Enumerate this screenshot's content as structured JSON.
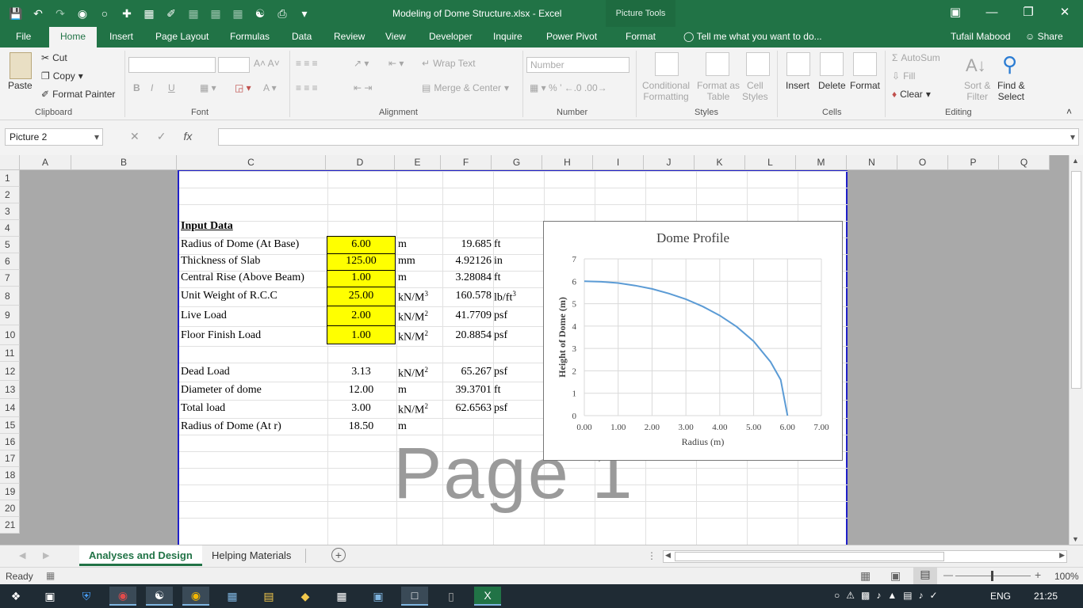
{
  "window": {
    "title": "Modeling of Dome Structure.xlsx - Excel",
    "context_tab": "Picture Tools"
  },
  "ribbon_tabs": [
    "File",
    "Home",
    "Insert",
    "Page Layout",
    "Formulas",
    "Data",
    "Review",
    "View",
    "Developer",
    "Inquire",
    "Power Pivot",
    "Format"
  ],
  "tell_me": "Tell me what you want to do...",
  "user": "Tufail Mabood",
  "share": "Share",
  "ribbon": {
    "clipboard": {
      "paste": "Paste",
      "cut": "Cut",
      "copy": "Copy",
      "format_painter": "Format Painter",
      "label": "Clipboard"
    },
    "font": {
      "label": "Font"
    },
    "alignment": {
      "wrap_text": "Wrap Text",
      "merge_center": "Merge & Center",
      "label": "Alignment"
    },
    "number": {
      "format": "Number",
      "label": "Number"
    },
    "styles": {
      "conditional": "Conditional",
      "formatting": "Formatting",
      "format_as": "Format as",
      "table": "Table",
      "cell": "Cell",
      "styles_txt": "Styles",
      "label": "Styles"
    },
    "cells": {
      "insert": "Insert",
      "delete": "Delete",
      "format": "Format",
      "label": "Cells"
    },
    "editing": {
      "autosum": "AutoSum",
      "fill": "Fill",
      "clear": "Clear",
      "sort": "Sort &",
      "filter": "Filter",
      "find": "Find &",
      "select": "Select",
      "label": "Editing"
    }
  },
  "name_box": "Picture 2",
  "columns": [
    "A",
    "B",
    "C",
    "D",
    "E",
    "F",
    "G",
    "H",
    "I",
    "J",
    "K",
    "L",
    "M",
    "N",
    "O",
    "P",
    "Q"
  ],
  "rows": [
    "1",
    "2",
    "3",
    "4",
    "5",
    "6",
    "7",
    "8",
    "9",
    "10",
    "11",
    "12",
    "13",
    "14",
    "15",
    "16",
    "17",
    "18",
    "19",
    "20",
    "21"
  ],
  "sheet": {
    "heading": "Input Data",
    "inputs": [
      {
        "label": "Radius of Dome (At Base)",
        "value": "6.00",
        "unit": "m",
        "sup": "",
        "conv": "19.685",
        "conv_unit": "ft",
        "conv_sup": ""
      },
      {
        "label": "Thickness of Slab",
        "value": "125.00",
        "unit": "mm",
        "sup": "",
        "conv": "4.92126",
        "conv_unit": "in",
        "conv_sup": ""
      },
      {
        "label": "Central Rise (Above Beam)",
        "value": "1.00",
        "unit": "m",
        "sup": "",
        "conv": "3.28084",
        "conv_unit": "ft",
        "conv_sup": ""
      },
      {
        "label": "Unit Weight of R.C.C",
        "value": "25.00",
        "unit": "kN/M",
        "sup": "3",
        "conv": "160.578",
        "conv_unit": "lb/ft",
        "conv_sup": "3"
      },
      {
        "label": "Live Load",
        "value": "2.00",
        "unit": "kN/M",
        "sup": "2",
        "conv": "41.7709",
        "conv_unit": "psf",
        "conv_sup": ""
      },
      {
        "label": "Floor Finish Load",
        "value": "1.00",
        "unit": "kN/M",
        "sup": "2",
        "conv": "20.8854",
        "conv_unit": "psf",
        "conv_sup": ""
      }
    ],
    "results": [
      {
        "label": "Dead Load",
        "value": "3.13",
        "unit": "kN/M",
        "sup": "2",
        "conv": "65.267",
        "conv_unit": "psf"
      },
      {
        "label": "Diameter of dome",
        "value": "12.00",
        "unit": "m",
        "sup": "",
        "conv": "39.3701",
        "conv_unit": "ft"
      },
      {
        "label": "Total load",
        "value": "3.00",
        "unit": "kN/M",
        "sup": "2",
        "conv": "62.6563",
        "conv_unit": "psf"
      },
      {
        "label": "Radius of Dome (At r)",
        "value": "18.50",
        "unit": "m",
        "sup": "",
        "conv": "",
        "conv_unit": ""
      }
    ],
    "watermark": "Page 1"
  },
  "chart_data": {
    "type": "line",
    "title": "Dome Profile",
    "xlabel": "Radius (m)",
    "ylabel": "Height of Dome (m)",
    "xlim": [
      0,
      7
    ],
    "ylim": [
      0,
      7
    ],
    "xticks": [
      "0.00",
      "1.00",
      "2.00",
      "3.00",
      "4.00",
      "5.00",
      "6.00",
      "7.00"
    ],
    "yticks": [
      "0",
      "1",
      "2",
      "3",
      "4",
      "5",
      "6",
      "7"
    ],
    "grid": true,
    "series": [
      {
        "x": [
          0,
          0.5,
          1,
          1.5,
          2,
          2.5,
          3,
          3.5,
          4,
          4.5,
          5,
          5.5,
          5.8,
          6.0
        ],
        "y": [
          6.0,
          5.98,
          5.92,
          5.81,
          5.66,
          5.45,
          5.2,
          4.87,
          4.47,
          3.97,
          3.32,
          2.4,
          1.6,
          0.0
        ],
        "color": "#5b9bd5"
      }
    ]
  },
  "sheet_tabs": [
    "Analyses and Design",
    "Helping Materials"
  ],
  "status": {
    "ready": "Ready",
    "zoom": "100%"
  },
  "taskbar": {
    "lang": "ENG",
    "time": "21:25"
  }
}
